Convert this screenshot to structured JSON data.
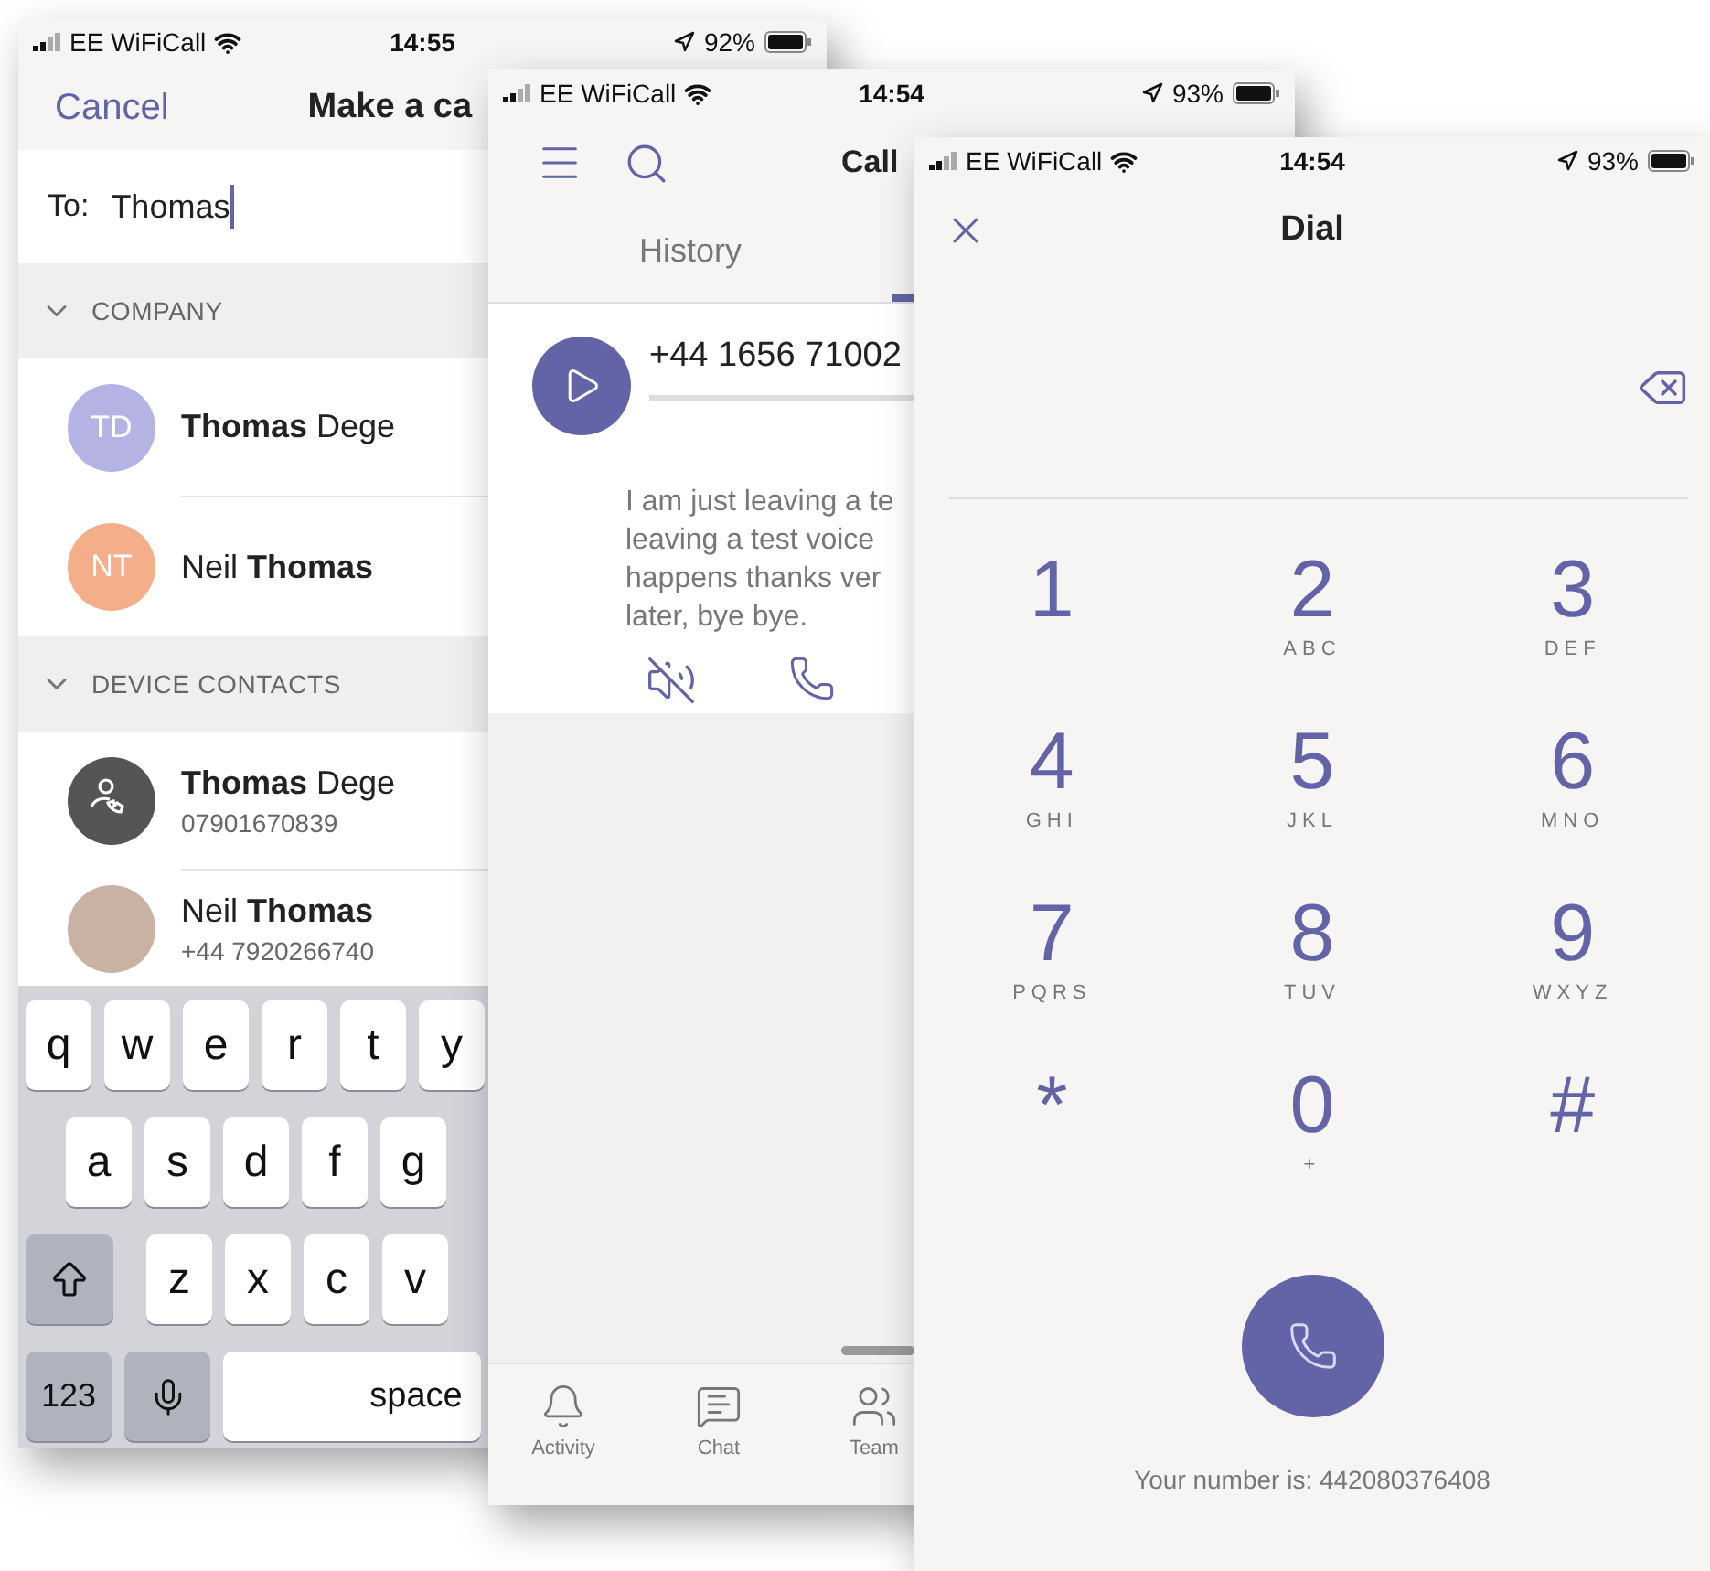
{
  "make_call": {
    "status": {
      "carrier": "EE WiFiCall",
      "time": "14:55",
      "battery": "92%"
    },
    "cancel": "Cancel",
    "title": "Make a ca",
    "to_label": "To:",
    "to_value": "Thomas",
    "sections": [
      {
        "title": "COMPANY",
        "expanded": true,
        "contacts": [
          {
            "name": "**Thomas** Dege",
            "kind": "initials",
            "initials": "TD",
            "color": "#b4b3e3"
          },
          {
            "name": "Neil **Thomas**",
            "kind": "initials",
            "initials": "NT",
            "color": "#f4ae89"
          }
        ]
      },
      {
        "title": "DEVICE CONTACTS",
        "expanded": true,
        "contacts": [
          {
            "name": "**Thomas** Dege",
            "kind": "device",
            "number": "07901670839"
          },
          {
            "name": "Neil **Thomas**",
            "kind": "photo",
            "number": "+44 7920266740"
          }
        ]
      }
    ],
    "keyboard": [
      [
        {
          "kind": "letter",
          "label": "q"
        },
        {
          "kind": "letter",
          "label": "w"
        },
        {
          "kind": "letter",
          "label": "e"
        },
        {
          "kind": "letter",
          "label": "r"
        },
        {
          "kind": "letter",
          "label": "t"
        },
        {
          "kind": "letter",
          "label": "y"
        }
      ],
      [
        {
          "kind": "letter",
          "label": "a"
        },
        {
          "kind": "letter",
          "label": "s"
        },
        {
          "kind": "letter",
          "label": "d"
        },
        {
          "kind": "letter",
          "label": "f"
        },
        {
          "kind": "letter",
          "label": "g"
        }
      ],
      [
        {
          "kind": "shift"
        },
        {
          "kind": "letter",
          "label": "z"
        },
        {
          "kind": "letter",
          "label": "x"
        },
        {
          "kind": "letter",
          "label": "c"
        },
        {
          "kind": "letter",
          "label": "v"
        }
      ],
      [
        {
          "kind": "function",
          "label": "123"
        },
        {
          "kind": "mic"
        },
        {
          "kind": "space",
          "label": "space"
        }
      ]
    ]
  },
  "calls": {
    "status": {
      "carrier": "EE WiFiCall",
      "time": "14:54",
      "battery": "93%"
    },
    "title": "Call",
    "tabs": [
      {
        "label": "History",
        "selected": false
      },
      {
        "selected": true
      }
    ],
    "voicemail": {
      "number": "+44 1656 71002",
      "transcript": [
        "I am just leaving a te",
        "leaving a test voice",
        "happens thanks ver",
        "later, bye bye."
      ]
    },
    "nav": [
      {
        "kind": "bell",
        "label": "Activity"
      },
      {
        "kind": "chat",
        "label": "Chat"
      },
      {
        "kind": "teams",
        "label": "Team"
      }
    ]
  },
  "dial": {
    "status": {
      "carrier": "EE WiFiCall",
      "time": "14:54",
      "battery": "93%"
    },
    "title": "Dial",
    "keypad": [
      {
        "digit": "1"
      },
      {
        "digit": "2",
        "letters": "ABC"
      },
      {
        "digit": "3",
        "letters": "DEF"
      },
      {
        "digit": "4",
        "letters": "GHI"
      },
      {
        "digit": "5",
        "letters": "JKL"
      },
      {
        "digit": "6",
        "letters": "MNO"
      },
      {
        "digit": "7",
        "letters": "PQRS"
      },
      {
        "digit": "8",
        "letters": "TUV"
      },
      {
        "digit": "9",
        "letters": "WXYZ"
      },
      {
        "digit": "*"
      },
      {
        "digit": "0",
        "letters": "+"
      },
      {
        "digit": "#"
      }
    ],
    "own_number": "Your number is: 442080376408"
  }
}
